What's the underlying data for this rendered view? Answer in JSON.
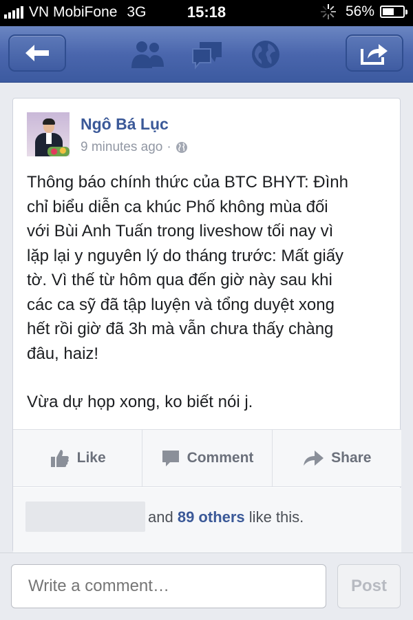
{
  "status_bar": {
    "carrier": "VN MobiFone",
    "network": "3G",
    "time": "15:18",
    "battery": "56%",
    "battery_level": 0.56
  },
  "nav": {
    "icons": [
      "back-arrow-icon",
      "friends-icon",
      "messages-icon",
      "globe-icon",
      "share-icon"
    ]
  },
  "post": {
    "author": "Ngô Bá Lục",
    "time_ago": "9 minutes ago",
    "separator": "·",
    "privacy_icon": "globe-icon",
    "paragraphs": [
      "Thông báo chính thức của BTC BHYT: Đình\nchỉ biểu diễn ca khúc Phố không mùa đối\nvới Bùi Anh Tuấn trong liveshow tối nay vì\nlặp lại y nguyên lý do tháng trước: Mất giấy\ntờ. Vì thế từ hôm qua đến giờ này sau khi\ncác ca sỹ đã tập luyện và tổng duyệt xong\nhết rồi giờ đã 3h mà vẫn chưa thấy chàng\nđâu, haiz!",
      "Vừa dự họp xong, ko biết nói j."
    ],
    "actions": {
      "like": "Like",
      "comment": "Comment",
      "share": "Share"
    },
    "likes": {
      "prefix": "and",
      "others": "89 others",
      "suffix": "like this."
    }
  },
  "composer": {
    "placeholder": "Write a comment…",
    "post_label": "Post"
  },
  "colors": {
    "nav_blue": "#3c5aa0",
    "link_blue": "#3b5998",
    "meta_gray": "#9197a3"
  }
}
